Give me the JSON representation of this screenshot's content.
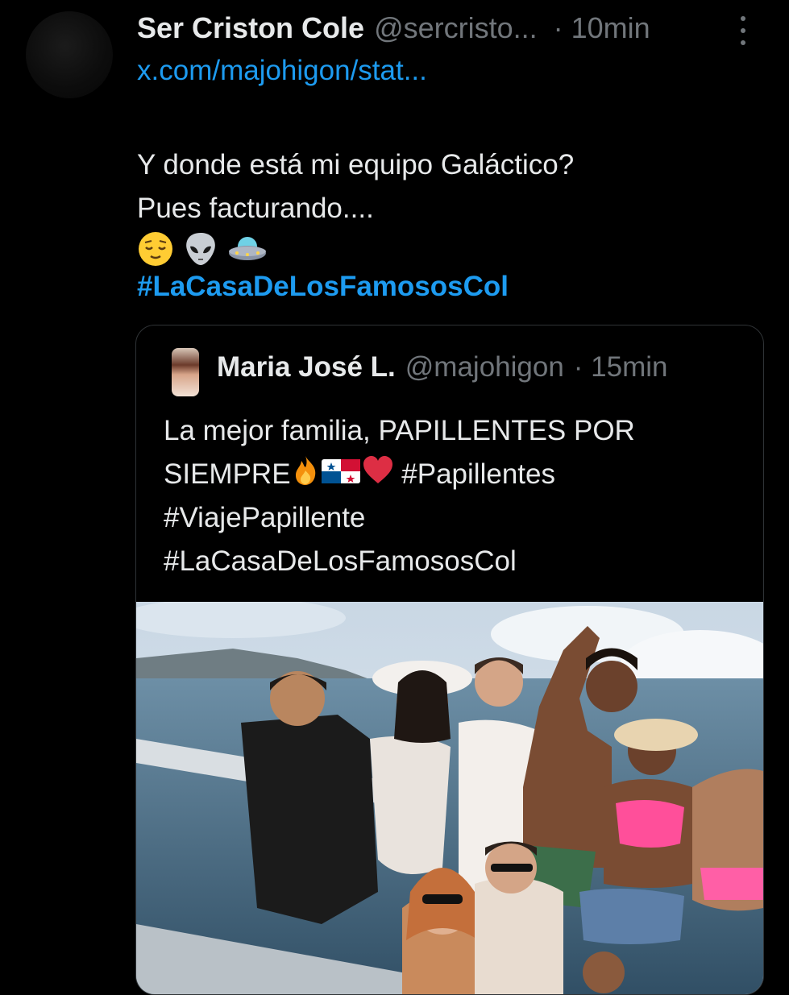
{
  "tweet": {
    "author_name": "Ser Criston Cole",
    "author_handle": "@sercristo...",
    "time": "· 10min",
    "link": "x.com/majohigon/stat...",
    "text_lines": [
      "Y donde está mi equipo Galáctico?",
      "Pues facturando...."
    ],
    "emojis": [
      "relieved-face",
      "alien",
      "flying-saucer"
    ],
    "hashtag": "#LaCasaDeLosFamososCol"
  },
  "quote": {
    "author_name": "Maria José L.",
    "author_handle": "@majohigon",
    "time": "· 15min",
    "line1": "La mejor familia, PAPILLENTES POR",
    "line2_start": "SIEMPRE",
    "line2_emojis": [
      "fire",
      "flag-panama",
      "red-heart"
    ],
    "line2_end": "#Papillentes",
    "line3": "#ViajePapillente",
    "line4": "#LaCasaDeLosFamososCol"
  },
  "colors": {
    "background": "#000000",
    "text": "#e7e9ea",
    "muted": "#71767b",
    "link": "#1d9bf0",
    "border": "#2f3336"
  }
}
